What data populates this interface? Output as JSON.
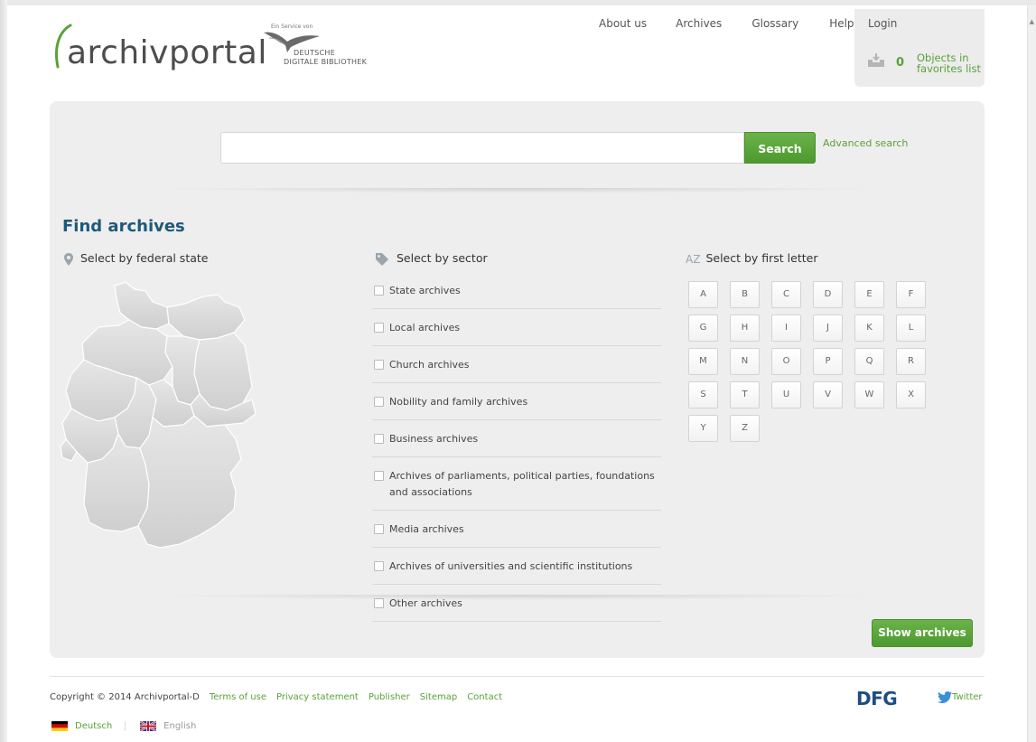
{
  "header": {
    "logo_text": "archivportal",
    "ddb_service": "Ein Service von",
    "ddb_name_1": "DEUTSCHE",
    "ddb_name_2": "DIGITALE BIBLIOTHEK",
    "nav": [
      "About us",
      "Archives",
      "Glossary",
      "Help"
    ],
    "login": "Login",
    "favorites_count": "0",
    "favorites_label": "Objects in favorites list"
  },
  "search": {
    "input_value": "",
    "button": "Search",
    "advanced": "Advanced search"
  },
  "find": {
    "title": "Find archives",
    "by_state": "Select by federal state",
    "by_sector": "Select by sector",
    "by_letter": "Select by first letter",
    "letter_icon": "AZ",
    "sectors": [
      "State archives",
      "Local archives",
      "Church archives",
      "Nobility and family archives",
      "Business archives",
      "Archives of parliaments, political parties, foundations and associations",
      "Media archives",
      "Archives of universities and scientific institutions",
      "Other archives"
    ],
    "letters": [
      "A",
      "B",
      "C",
      "D",
      "E",
      "F",
      "G",
      "H",
      "I",
      "J",
      "K",
      "L",
      "M",
      "N",
      "O",
      "P",
      "Q",
      "R",
      "S",
      "T",
      "U",
      "V",
      "W",
      "X",
      "Y",
      "Z"
    ],
    "show_button": "Show archives"
  },
  "footer": {
    "copyright": "Copyright © 2014 Archivportal-D",
    "links": [
      "Terms of use",
      "Privacy statement",
      "Publisher",
      "Sitemap",
      "Contact"
    ],
    "dfg": "DFG",
    "twitter": "Twitter",
    "lang_de": "Deutsch",
    "lang_en": "English"
  },
  "colors": {
    "accent_green": "#5aa13a",
    "title_blue": "#1e5a7a",
    "panel_bg": "#eeeeee"
  }
}
